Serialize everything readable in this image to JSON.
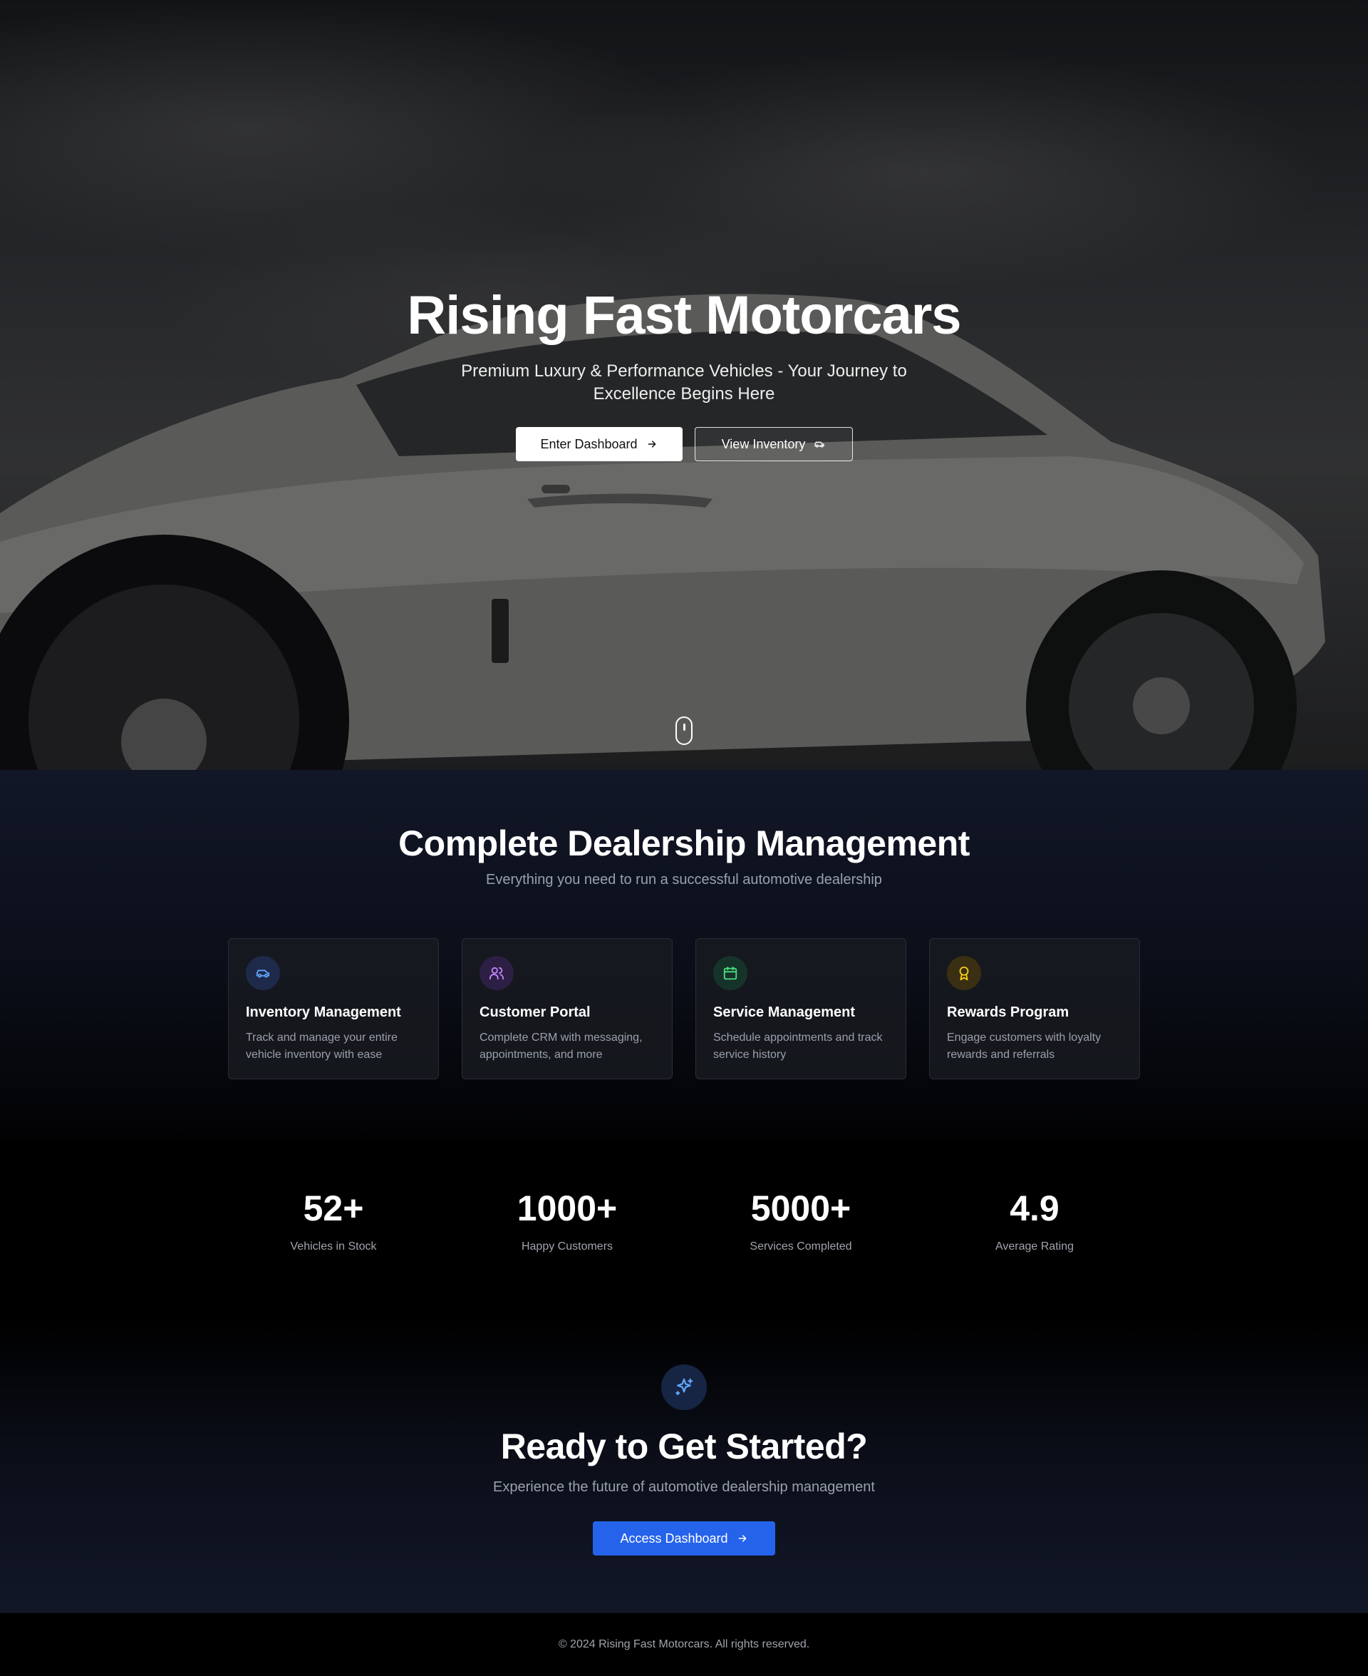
{
  "hero": {
    "title": "Rising Fast Motorcars",
    "subtitle": "Premium Luxury & Performance Vehicles - Your Journey to Excellence Begins Here",
    "primary_button": "Enter Dashboard",
    "primary_button_icon": "arrow-right-icon",
    "secondary_button": "View Inventory",
    "secondary_button_icon": "car-icon",
    "scroll_icon": "mouse-scroll-icon"
  },
  "features": {
    "title": "Complete Dealership Management",
    "subtitle": "Everything you need to run a successful automotive dealership",
    "cards": [
      {
        "icon": "car-icon",
        "color": "#60a5fa",
        "bg": "#1e2a4a",
        "title": "Inventory Management",
        "description": "Track and manage your entire vehicle inventory with ease"
      },
      {
        "icon": "users-icon",
        "color": "#c084fc",
        "bg": "#2d1f44",
        "title": "Customer Portal",
        "description": "Complete CRM with messaging, appointments, and more"
      },
      {
        "icon": "calendar-icon",
        "color": "#4ade80",
        "bg": "#16332a",
        "title": "Service Management",
        "description": "Schedule appointments and track service history"
      },
      {
        "icon": "award-icon",
        "color": "#facc15",
        "bg": "#3a2f12",
        "title": "Rewards Program",
        "description": "Engage customers with loyalty rewards and referrals"
      }
    ]
  },
  "stats": [
    {
      "value": "52+",
      "label": "Vehicles in Stock"
    },
    {
      "value": "1000+",
      "label": "Happy Customers"
    },
    {
      "value": "5000+",
      "label": "Services Completed"
    },
    {
      "value": "4.9",
      "label": "Average Rating"
    }
  ],
  "cta": {
    "icon": "sparkles-icon",
    "title": "Ready to Get Started?",
    "subtitle": "Experience the future of automotive dealership management",
    "button": "Access Dashboard",
    "button_icon": "arrow-right-icon",
    "accent": "#2563eb"
  },
  "footer": {
    "copyright": "© 2024 Rising Fast Motorcars. All rights reserved."
  }
}
